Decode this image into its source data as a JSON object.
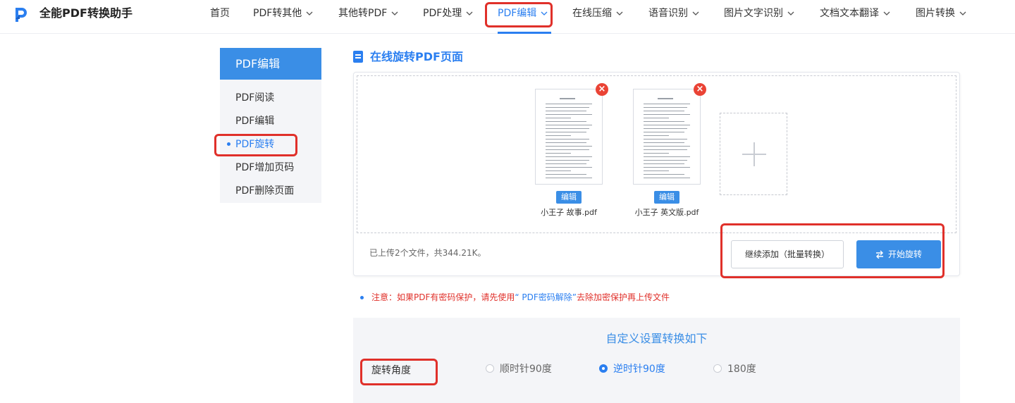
{
  "header": {
    "brand": "全能PDF转换助手",
    "nav": [
      {
        "label": "首页",
        "has_menu": false
      },
      {
        "label": "PDF转其他",
        "has_menu": true
      },
      {
        "label": "其他转PDF",
        "has_menu": true
      },
      {
        "label": "PDF处理",
        "has_menu": true
      },
      {
        "label": "PDF编辑",
        "has_menu": true,
        "active": true
      },
      {
        "label": "在线压缩",
        "has_menu": true
      },
      {
        "label": "语音识别",
        "has_menu": true
      },
      {
        "label": "图片文字识别",
        "has_menu": true
      },
      {
        "label": "文档文本翻译",
        "has_menu": true
      },
      {
        "label": "图片转换",
        "has_menu": true
      }
    ]
  },
  "sidebar": {
    "title": "PDF编辑",
    "items": [
      {
        "label": "PDF阅读"
      },
      {
        "label": "PDF编辑"
      },
      {
        "label": "PDF旋转",
        "active": true
      },
      {
        "label": "PDF增加页码"
      },
      {
        "label": "PDF删除页面"
      }
    ]
  },
  "main": {
    "section_title": "在线旋转PDF页面",
    "files": [
      {
        "name": "小王子 故事.pdf",
        "edit_label": "编辑"
      },
      {
        "name": "小王子 英文版.pdf",
        "edit_label": "编辑"
      }
    ],
    "upload_status": "已上传2个文件，共344.21K。",
    "continue_button": "继续添加（批量转换）",
    "start_button": "开始旋转",
    "note_prefix": "注意：如果PDF有密码保护，请先使用",
    "note_link": "“ PDF密码解除”",
    "note_suffix": "去除加密保护再上传文件"
  },
  "settings": {
    "title": "自定义设置转换如下",
    "rotation_label": "旋转角度",
    "options": [
      {
        "label": "顺时针90度",
        "selected": false
      },
      {
        "label": "逆时针90度",
        "selected": true
      },
      {
        "label": "180度",
        "selected": false
      }
    ]
  },
  "colors": {
    "accent": "#2b7ff0",
    "highlight": "#e0302a",
    "delete": "#ea4335"
  }
}
